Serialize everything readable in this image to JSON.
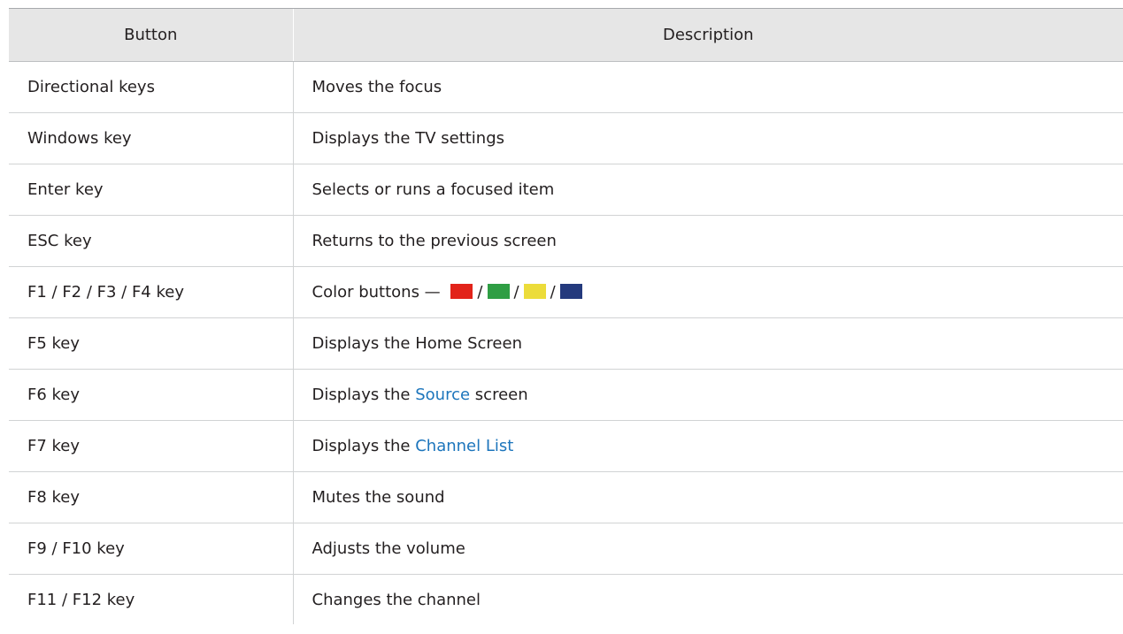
{
  "table": {
    "headers": {
      "button": "Button",
      "description": "Description"
    },
    "rows": [
      {
        "button": "Directional keys",
        "description": "Moves the focus"
      },
      {
        "button": "Windows key",
        "description": "Displays the TV settings"
      },
      {
        "button": "Enter key",
        "description": "Selects or runs a focused item"
      },
      {
        "button": "ESC key",
        "description": "Returns to the previous screen"
      },
      {
        "button": "F1 / F2 / F3 / F4 key",
        "description_prefix": "Color buttons —",
        "separator": "/",
        "colors": [
          "#e2231a",
          "#2f9e44",
          "#ecdc3a",
          "#243a7d"
        ]
      },
      {
        "button": "F5 key",
        "description": "Displays the Home Screen"
      },
      {
        "button": "F6 key",
        "description_prefix": "Displays the",
        "description_link": "Source",
        "description_suffix": "screen"
      },
      {
        "button": "F7 key",
        "description_prefix": "Displays the",
        "description_link": "Channel List"
      },
      {
        "button": "F8 key",
        "description": "Mutes the sound"
      },
      {
        "button": "F9 / F10 key",
        "description": "Adjusts the volume"
      },
      {
        "button": "F11 / F12 key",
        "description": "Changes the channel"
      }
    ],
    "link_color": "#1c75bc"
  }
}
